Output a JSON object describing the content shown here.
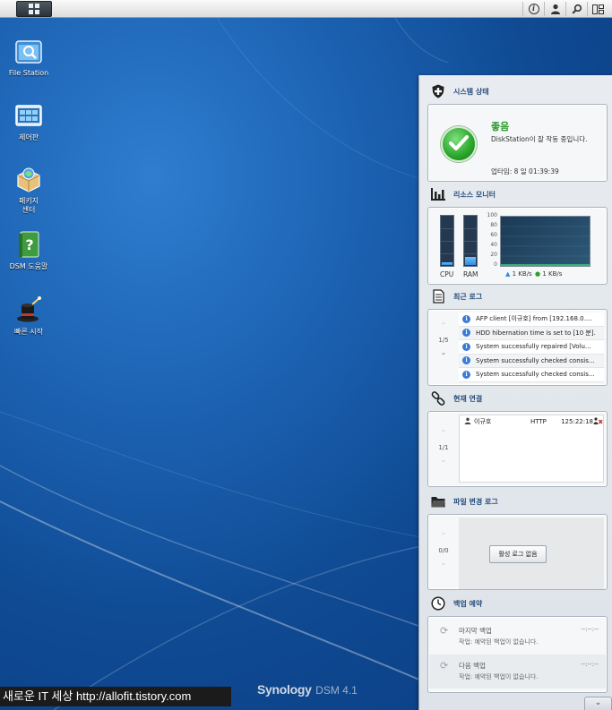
{
  "taskbar": {
    "main_menu_icon": "grid-icon",
    "right_icons": [
      "info-icon",
      "user-icon",
      "search-icon",
      "widgets-icon"
    ],
    "info_glyph": "i"
  },
  "desktop": {
    "icons": [
      {
        "label": "File Station",
        "icon": "folder-search-icon"
      },
      {
        "label": "제어판",
        "icon": "control-panel-icon"
      },
      {
        "label": "패키지\n센터",
        "icon": "package-center-icon"
      },
      {
        "label": "DSM 도움말",
        "icon": "help-book-icon"
      },
      {
        "label": "빠른 시작",
        "icon": "magic-hat-icon"
      }
    ]
  },
  "widgets": {
    "system_status": {
      "title": "시스템 상태",
      "state": "좋음",
      "description": "DiskStation이 잘 작동 중입니다.",
      "uptime": "업타임: 8 일 01:39:39"
    },
    "resource_monitor": {
      "title": "리소스 모니터",
      "cpu_label": "CPU",
      "ram_label": "RAM",
      "cpu_usage": 0.06,
      "ram_usage": 0.16,
      "graph_ticks": [
        "100",
        "80",
        "60",
        "40",
        "20",
        "0"
      ],
      "upload": "1 KB/s",
      "download": "1 KB/s"
    },
    "recent_logs": {
      "title": "최근 로그",
      "page": "1/5",
      "rows": [
        "AFP client [이규호] from [192.168.0....",
        "HDD hibernation time is set to [10 분].",
        "System successfully repaired [Volu...",
        "System successfully checked consis...",
        "System successfully checked consis..."
      ]
    },
    "connections": {
      "title": "현재 연결",
      "page": "1/1",
      "rows": [
        {
          "user": "이규호",
          "type": "HTTP",
          "time": "125:22:18"
        }
      ]
    },
    "file_change_log": {
      "title": "파일 변경 로그",
      "page": "0/0",
      "button": "활성 로그 없음"
    },
    "backup": {
      "title": "백업 예약",
      "rows": [
        {
          "name": "마지막 백업",
          "time": "--:--:--",
          "desc": "작업: 예약된 백업이 없습니다."
        },
        {
          "name": "다음 백업",
          "time": "--:--:--",
          "desc": "작업: 예약된 백업이 없습니다."
        }
      ]
    }
  },
  "footer": {
    "watermark": "새로운 IT 세상 http://allofit.tistory.com",
    "brand_name": "Synology",
    "brand_version": "DSM 4.1"
  },
  "colors": {
    "accent": "#2a4f7c",
    "status_good": "#2c9a2c",
    "desktop_bg": "#1a5fae"
  }
}
